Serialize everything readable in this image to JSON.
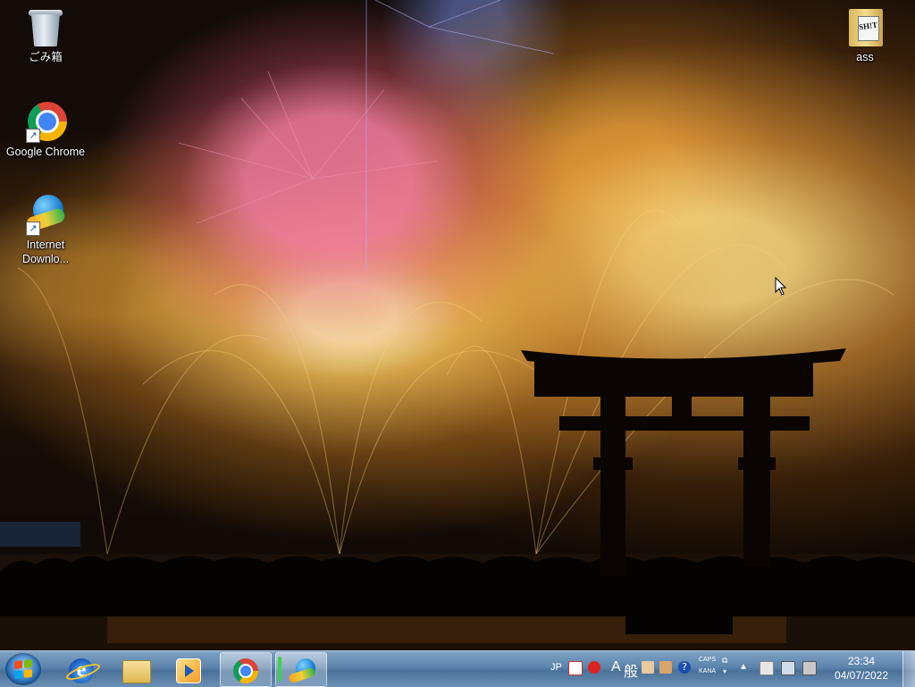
{
  "desktop": {
    "icons": [
      {
        "label": "ごみ箱",
        "icon": "recycle-bin-icon"
      },
      {
        "label": "Google Chrome",
        "icon": "chrome-icon"
      },
      {
        "label": "Internet\nDownlo...",
        "icon": "idm-icon"
      },
      {
        "label": "ass",
        "icon": "folder-icon"
      }
    ],
    "folder_overlay_text": "SH!T"
  },
  "taskbar": {
    "pinned": [
      {
        "name": "internet-explorer",
        "icon": "ie-icon",
        "active": false
      },
      {
        "name": "windows-explorer",
        "icon": "folder-icon",
        "active": false
      },
      {
        "name": "media-player",
        "icon": "media-player-icon",
        "active": false
      },
      {
        "name": "google-chrome",
        "icon": "chrome-icon",
        "active": true
      },
      {
        "name": "internet-download-manager",
        "icon": "idm-icon",
        "active": true
      }
    ],
    "tray": {
      "language": "JP",
      "ime_mode": "A",
      "ime_kanji": "般",
      "caps_label": "CAPS",
      "kana_label": "KANA",
      "clock_time": "23:34",
      "clock_date": "04/07/2022"
    }
  },
  "colors": {
    "taskbar": "#5c83ab",
    "wallpaper_glow": "#f0b040"
  }
}
